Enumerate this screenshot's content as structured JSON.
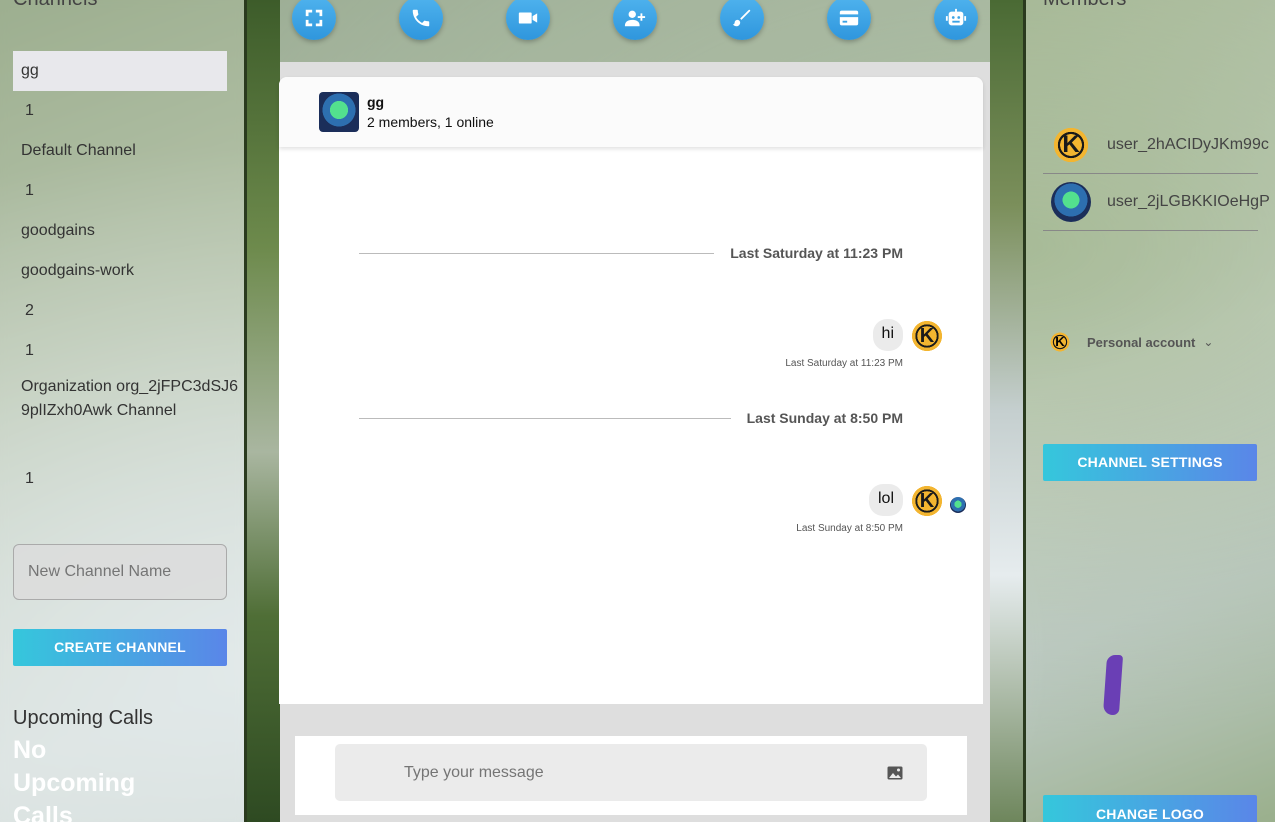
{
  "left_panel": {
    "title": "Channels",
    "channels": [
      {
        "label": "gg",
        "active": true
      },
      {
        "label": "1"
      },
      {
        "label": "Default Channel"
      },
      {
        "label": "1"
      },
      {
        "label": "goodgains"
      },
      {
        "label": "goodgains-work"
      },
      {
        "label": "2"
      },
      {
        "label": "1"
      },
      {
        "label": "Organization org_2jFPC3dSJ69plIZxh0Awk Channel"
      },
      {
        "label": "1"
      }
    ],
    "new_channel_placeholder": "New Channel Name",
    "create_button": "CREATE CHANNEL",
    "upcoming_title": "Upcoming Calls",
    "upcoming_empty": "No Upcoming Calls"
  },
  "toolbar": {
    "buttons": [
      {
        "icon": "fullscreen-icon"
      },
      {
        "icon": "phone-icon"
      },
      {
        "icon": "video-icon"
      },
      {
        "icon": "add-user-icon"
      },
      {
        "icon": "brush-icon"
      },
      {
        "icon": "credit-card-icon"
      },
      {
        "icon": "robot-icon"
      }
    ]
  },
  "chat": {
    "channel_name": "gg",
    "channel_meta": "2 members, 1 online",
    "separators": [
      {
        "label": "Last Saturday at 11:23 PM"
      },
      {
        "label": "Last Sunday at 8:50 PM"
      }
    ],
    "messages": [
      {
        "text": "hi",
        "time": "Last Saturday at 11:23 PM"
      },
      {
        "text": "lol",
        "time": "Last Sunday at 8:50 PM"
      }
    ],
    "composer_placeholder": "Type your message"
  },
  "right_panel": {
    "title": "Members",
    "members": [
      {
        "name": "user_2hACIDyJKm99c"
      },
      {
        "name": "user_2jLGBKKIOeHgP"
      }
    ],
    "account_label": "Personal account",
    "settings_button": "CHANNEL SETTINGS",
    "logo_button": "CHANGE LOGO"
  },
  "colors": {
    "button_gradient_start": "#35c7dc",
    "button_gradient_end": "#5a86e8",
    "toolbar_blue": "#3a9fe4"
  }
}
